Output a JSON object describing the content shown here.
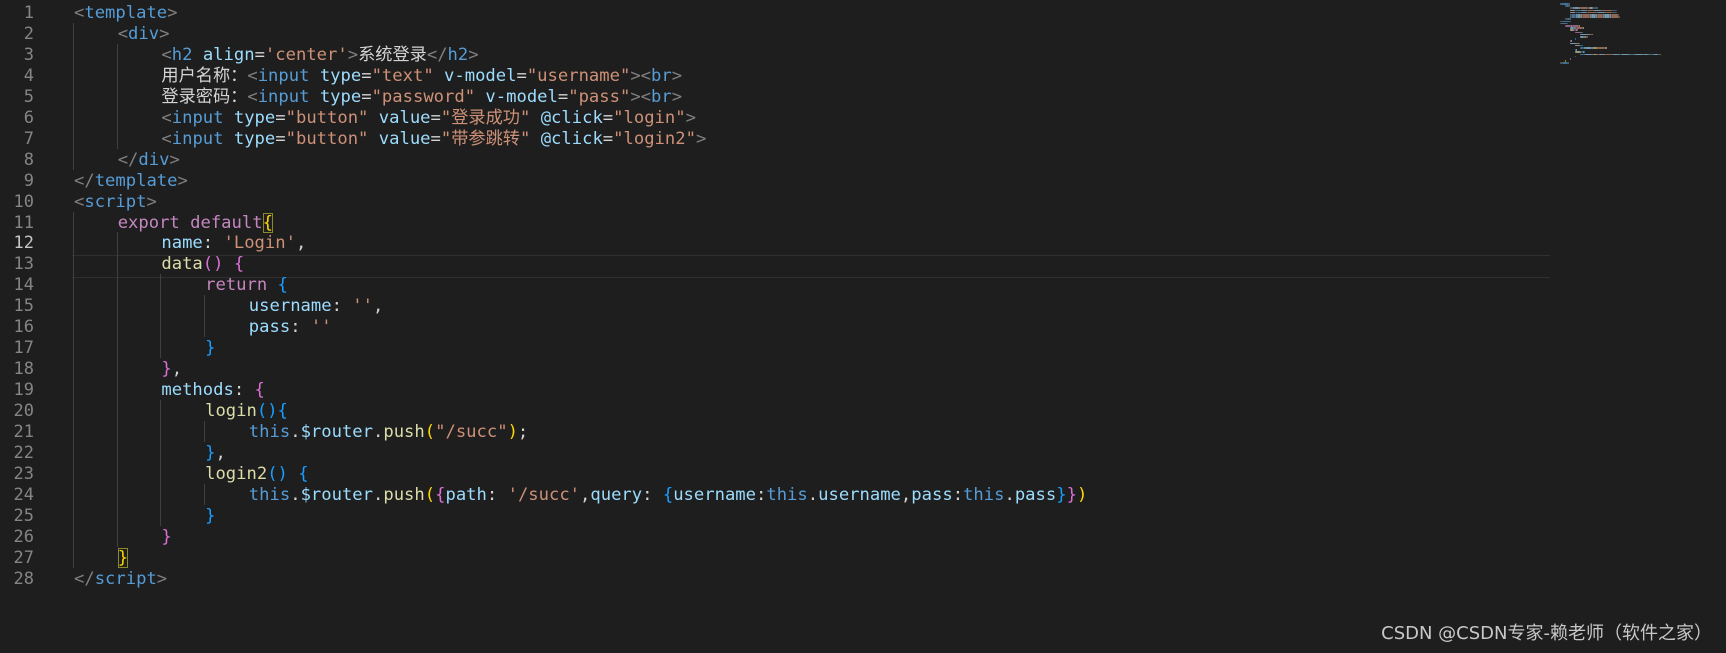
{
  "colors": {
    "background": "#1e1e1e",
    "line_number": "#858585",
    "line_number_active": "#c6c6c6",
    "tag_bracket": "#808080",
    "tag_name": "#569cd6",
    "attribute_name": "#9cdcfe",
    "string": "#ce9178",
    "keyword_control": "#c586c0",
    "function": "#dcdcaa",
    "punctuation": "#d4d4d4",
    "bracket_gold": "#ffd700",
    "bracket_purple": "#da70d6",
    "bracket_blue": "#179fff"
  },
  "editor": {
    "active_line": 12,
    "lines": [
      [
        [
          "tag_bracket",
          "<"
        ],
        [
          "tag_name",
          "template"
        ],
        [
          "tag_bracket",
          ">"
        ]
      ],
      [
        [
          "tag_bracket",
          "<"
        ],
        [
          "tag_name",
          "div"
        ],
        [
          "tag_bracket",
          ">"
        ]
      ],
      [
        [
          "tag_bracket",
          "<"
        ],
        [
          "tag_name",
          "h2"
        ],
        [
          "punctuation",
          " "
        ],
        [
          "attribute_name",
          "align"
        ],
        [
          "punctuation",
          "="
        ],
        [
          "string",
          "'center'"
        ],
        [
          "tag_bracket",
          ">"
        ],
        [
          "punctuation",
          "系统登录"
        ],
        [
          "tag_bracket",
          "</"
        ],
        [
          "tag_name",
          "h2"
        ],
        [
          "tag_bracket",
          ">"
        ]
      ],
      [
        [
          "punctuation",
          "用户名称："
        ],
        [
          "tag_bracket",
          "<"
        ],
        [
          "tag_name",
          "input"
        ],
        [
          "punctuation",
          " "
        ],
        [
          "attribute_name",
          "type"
        ],
        [
          "punctuation",
          "="
        ],
        [
          "string",
          "\"text\""
        ],
        [
          "punctuation",
          " "
        ],
        [
          "attribute_name",
          "v-model"
        ],
        [
          "punctuation",
          "="
        ],
        [
          "string",
          "\"username\""
        ],
        [
          "tag_bracket",
          "><"
        ],
        [
          "tag_name",
          "br"
        ],
        [
          "tag_bracket",
          ">"
        ]
      ],
      [
        [
          "punctuation",
          "登录密码："
        ],
        [
          "tag_bracket",
          "<"
        ],
        [
          "tag_name",
          "input"
        ],
        [
          "punctuation",
          " "
        ],
        [
          "attribute_name",
          "type"
        ],
        [
          "punctuation",
          "="
        ],
        [
          "string",
          "\"password\""
        ],
        [
          "punctuation",
          " "
        ],
        [
          "attribute_name",
          "v-model"
        ],
        [
          "punctuation",
          "="
        ],
        [
          "string",
          "\"pass\""
        ],
        [
          "tag_bracket",
          "><"
        ],
        [
          "tag_name",
          "br"
        ],
        [
          "tag_bracket",
          ">"
        ]
      ],
      [
        [
          "tag_bracket",
          "<"
        ],
        [
          "tag_name",
          "input"
        ],
        [
          "punctuation",
          " "
        ],
        [
          "attribute_name",
          "type"
        ],
        [
          "punctuation",
          "="
        ],
        [
          "string",
          "\"button\""
        ],
        [
          "punctuation",
          " "
        ],
        [
          "attribute_name",
          "value"
        ],
        [
          "punctuation",
          "="
        ],
        [
          "string",
          "\"登录成功\""
        ],
        [
          "punctuation",
          " "
        ],
        [
          "attribute_name",
          "@click"
        ],
        [
          "punctuation",
          "="
        ],
        [
          "string",
          "\"login\""
        ],
        [
          "tag_bracket",
          ">"
        ]
      ],
      [
        [
          "tag_bracket",
          "<"
        ],
        [
          "tag_name",
          "input"
        ],
        [
          "punctuation",
          " "
        ],
        [
          "attribute_name",
          "type"
        ],
        [
          "punctuation",
          "="
        ],
        [
          "string",
          "\"button\""
        ],
        [
          "punctuation",
          " "
        ],
        [
          "attribute_name",
          "value"
        ],
        [
          "punctuation",
          "="
        ],
        [
          "string",
          "\"带参跳转\""
        ],
        [
          "punctuation",
          " "
        ],
        [
          "attribute_name",
          "@click"
        ],
        [
          "punctuation",
          "="
        ],
        [
          "string",
          "\"login2\""
        ],
        [
          "tag_bracket",
          ">"
        ]
      ],
      [
        [
          "tag_bracket",
          "</"
        ],
        [
          "tag_name",
          "div"
        ],
        [
          "tag_bracket",
          ">"
        ]
      ],
      [
        [
          "tag_bracket",
          "</"
        ],
        [
          "tag_name",
          "template"
        ],
        [
          "tag_bracket",
          ">"
        ]
      ],
      [
        [
          "tag_bracket",
          "<"
        ],
        [
          "tag_name",
          "script"
        ],
        [
          "tag_bracket",
          ">"
        ]
      ],
      [
        [
          "keyword_control",
          "export"
        ],
        [
          "punctuation",
          " "
        ],
        [
          "keyword_control",
          "default"
        ],
        [
          "bracket_gold",
          "{"
        ]
      ],
      [
        [
          "attribute_name",
          "name"
        ],
        [
          "punctuation",
          ": "
        ],
        [
          "string",
          "'Login'"
        ],
        [
          "punctuation",
          ","
        ]
      ],
      [
        [
          "function",
          "data"
        ],
        [
          "bracket_purple",
          "()"
        ],
        [
          "punctuation",
          " "
        ],
        [
          "bracket_purple",
          "{"
        ]
      ],
      [
        [
          "keyword_control",
          "return"
        ],
        [
          "punctuation",
          " "
        ],
        [
          "bracket_blue",
          "{"
        ]
      ],
      [
        [
          "attribute_name",
          "username"
        ],
        [
          "punctuation",
          ": "
        ],
        [
          "string",
          "''"
        ],
        [
          "punctuation",
          ","
        ]
      ],
      [
        [
          "attribute_name",
          "pass"
        ],
        [
          "punctuation",
          ": "
        ],
        [
          "string",
          "''"
        ]
      ],
      [
        [
          "bracket_blue",
          "}"
        ]
      ],
      [
        [
          "bracket_purple",
          "}"
        ],
        [
          "punctuation",
          ","
        ]
      ],
      [
        [
          "attribute_name",
          "methods"
        ],
        [
          "punctuation",
          ": "
        ],
        [
          "bracket_purple",
          "{"
        ]
      ],
      [
        [
          "function",
          "login"
        ],
        [
          "bracket_blue",
          "(){"
        ]
      ],
      [
        [
          "tag_name",
          "this"
        ],
        [
          "punctuation",
          "."
        ],
        [
          "attribute_name",
          "$router"
        ],
        [
          "punctuation",
          "."
        ],
        [
          "function",
          "push"
        ],
        [
          "bracket_gold",
          "("
        ],
        [
          "string",
          "\"/succ\""
        ],
        [
          "bracket_gold",
          ")"
        ],
        [
          "punctuation",
          ";"
        ]
      ],
      [
        [
          "bracket_blue",
          "}"
        ],
        [
          "punctuation",
          ","
        ]
      ],
      [
        [
          "function",
          "login2"
        ],
        [
          "bracket_blue",
          "()"
        ],
        [
          "punctuation",
          " "
        ],
        [
          "bracket_blue",
          "{"
        ]
      ],
      [
        [
          "tag_name",
          "this"
        ],
        [
          "punctuation",
          "."
        ],
        [
          "attribute_name",
          "$router"
        ],
        [
          "punctuation",
          "."
        ],
        [
          "function",
          "push"
        ],
        [
          "bracket_gold",
          "("
        ],
        [
          "bracket_purple",
          "{"
        ],
        [
          "attribute_name",
          "path"
        ],
        [
          "punctuation",
          ": "
        ],
        [
          "string",
          "'/succ'"
        ],
        [
          "punctuation",
          ","
        ],
        [
          "attribute_name",
          "query"
        ],
        [
          "punctuation",
          ": "
        ],
        [
          "bracket_blue",
          "{"
        ],
        [
          "attribute_name",
          "username"
        ],
        [
          "punctuation",
          ":"
        ],
        [
          "tag_name",
          "this"
        ],
        [
          "punctuation",
          "."
        ],
        [
          "attribute_name",
          "username"
        ],
        [
          "punctuation",
          ","
        ],
        [
          "attribute_name",
          "pass"
        ],
        [
          "punctuation",
          ":"
        ],
        [
          "tag_name",
          "this"
        ],
        [
          "punctuation",
          "."
        ],
        [
          "attribute_name",
          "pass"
        ],
        [
          "bracket_blue",
          "}"
        ],
        [
          "bracket_purple",
          "}"
        ],
        [
          "bracket_gold",
          ")"
        ]
      ],
      [
        [
          "bracket_blue",
          "}"
        ]
      ],
      [
        [
          "bracket_purple",
          "}"
        ]
      ],
      [
        [
          "bracket_gold",
          "}"
        ]
      ],
      [
        [
          "tag_bracket",
          "</"
        ],
        [
          "tag_name",
          "script"
        ],
        [
          "tag_bracket",
          ">"
        ]
      ]
    ]
  },
  "watermark": "CSDN @CSDN专家-赖老师（软件之家）"
}
